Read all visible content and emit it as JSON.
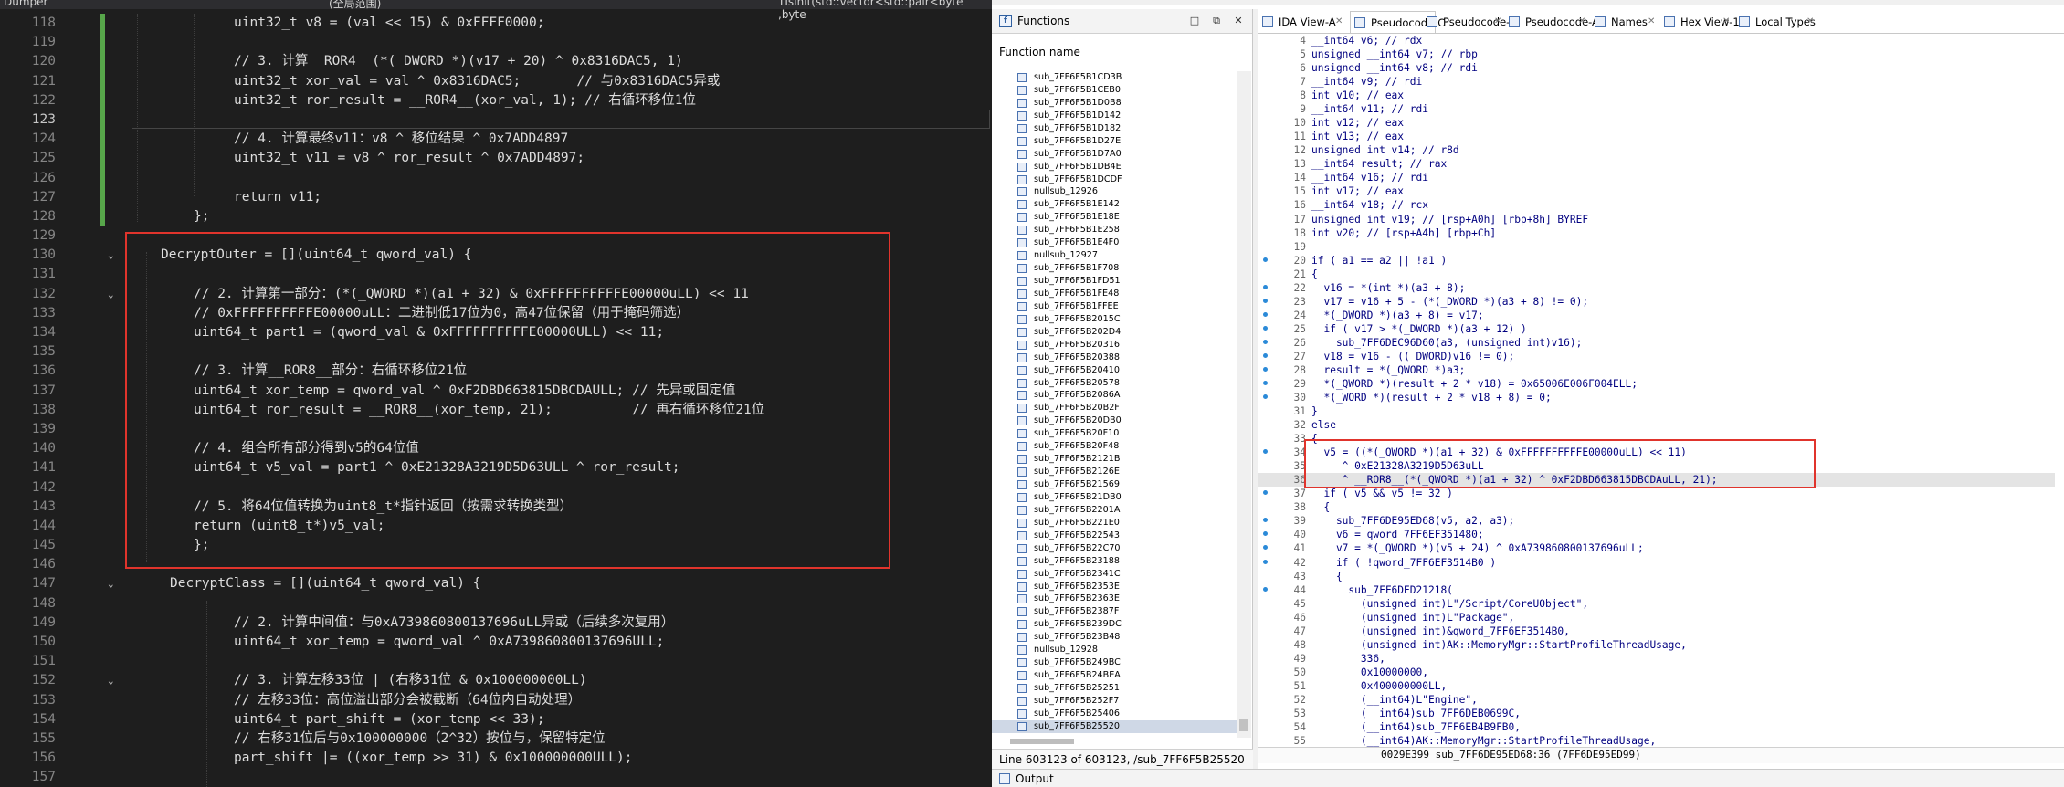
{
  "editor": {
    "window_title": "Dumper",
    "scope_label": "(全局范围)",
    "symbol_label": "TIsInit(std::vector<std::pair<byte ,byte",
    "lines": [
      {
        "n": "118",
        "indent": 2,
        "text": "uint32_t v8 = (val << 15) & 0xFFFF0000;"
      },
      {
        "n": "119",
        "indent": 0,
        "text": ""
      },
      {
        "n": "120",
        "indent": 2,
        "text": "// 3. 计算__ROR4__(*(_DWORD *)(v17 + 20) ^ 0x8316DAC5, 1)"
      },
      {
        "n": "121",
        "indent": 2,
        "text": "uint32_t xor_val = val ^ 0x8316DAC5;       // 与0x8316DAC5异或"
      },
      {
        "n": "122",
        "indent": 2,
        "text": "uint32_t ror_result = __ROR4__(xor_val, 1); // 右循环移位1位"
      },
      {
        "n": "123",
        "indent": 0,
        "text": ""
      },
      {
        "n": "124",
        "indent": 2,
        "text": "// 4. 计算最终v11：v8 ^ 移位结果 ^ 0x7ADD4897"
      },
      {
        "n": "125",
        "indent": 2,
        "text": "uint32_t v11 = v8 ^ ror_result ^ 0x7ADD4897;"
      },
      {
        "n": "126",
        "indent": 0,
        "text": ""
      },
      {
        "n": "127",
        "indent": 2,
        "text": "return v11;"
      },
      {
        "n": "128",
        "indent": 1,
        "text": "};"
      },
      {
        "n": "129",
        "indent": 0,
        "text": ""
      },
      {
        "n": "130",
        "indent": 0,
        "text": "DecryptOuter = [](uint64_t qword_val) {"
      },
      {
        "n": "131",
        "indent": 0,
        "text": ""
      },
      {
        "n": "132",
        "indent": 1,
        "text": "// 2. 计算第一部分：(*(_QWORD *)(a1 + 32) & 0xFFFFFFFFFFE00000uLL) << 11"
      },
      {
        "n": "133",
        "indent": 1,
        "text": "// 0xFFFFFFFFFFE00000uLL：二进制低17位为0，高47位保留（用于掩码筛选）"
      },
      {
        "n": "134",
        "indent": 1,
        "text": "uint64_t part1 = (qword_val & 0xFFFFFFFFFFE00000ULL) << 11;"
      },
      {
        "n": "135",
        "indent": 0,
        "text": ""
      },
      {
        "n": "136",
        "indent": 1,
        "text": "// 3. 计算__ROR8__部分：右循环移位21位"
      },
      {
        "n": "137",
        "indent": 1,
        "text": "uint64_t xor_temp = qword_val ^ 0xF2DBD663815DBCDAULL; // 先异或固定值"
      },
      {
        "n": "138",
        "indent": 1,
        "text": "uint64_t ror_result = __ROR8__(xor_temp, 21);          // 再右循环移位21位"
      },
      {
        "n": "139",
        "indent": 0,
        "text": ""
      },
      {
        "n": "140",
        "indent": 1,
        "text": "// 4. 组合所有部分得到v5的64位值"
      },
      {
        "n": "141",
        "indent": 1,
        "text": "uint64_t v5_val = part1 ^ 0xE21328A3219D5D63ULL ^ ror_result;"
      },
      {
        "n": "142",
        "indent": 0,
        "text": ""
      },
      {
        "n": "143",
        "indent": 1,
        "text": "// 5. 将64位值转换为uint8_t*指针返回（按需求转换类型）"
      },
      {
        "n": "144",
        "indent": 1,
        "text": "return (uint8_t*)v5_val;"
      },
      {
        "n": "145",
        "indent": 1,
        "text": "};"
      },
      {
        "n": "146",
        "indent": 0,
        "text": ""
      },
      {
        "n": "147",
        "indent": 0,
        "text": "DecryptClass = [](uint64_t qword_val) {"
      },
      {
        "n": "148",
        "indent": 0,
        "text": ""
      },
      {
        "n": "149",
        "indent": 2,
        "text": "// 2. 计算中间值：与0xA739860800137696uLL异或（后续多次复用）"
      },
      {
        "n": "150",
        "indent": 2,
        "text": "uint64_t xor_temp = qword_val ^ 0xA739860800137696ULL;"
      },
      {
        "n": "151",
        "indent": 0,
        "text": ""
      },
      {
        "n": "152",
        "indent": 2,
        "text": "// 3. 计算左移33位 | (右移31位 & 0x100000000LL)"
      },
      {
        "n": "153",
        "indent": 2,
        "text": "// 左移33位：高位溢出部分会被截断（64位内自动处理）"
      },
      {
        "n": "154",
        "indent": 2,
        "text": "uint64_t part_shift = (xor_temp << 33);"
      },
      {
        "n": "155",
        "indent": 2,
        "text": "// 右移31位后与0x100000000（2^32）按位与，保留特定位"
      },
      {
        "n": "156",
        "indent": 2,
        "text": "part_shift |= ((xor_temp >> 31) & 0x100000000ULL);"
      },
      {
        "n": "157",
        "indent": 0,
        "text": ""
      }
    ]
  },
  "functions": {
    "title": "Functions",
    "column_header": "Function name",
    "items": [
      "sub_7FF6F5B1CD3B",
      "sub_7FF6F5B1CEB0",
      "sub_7FF6F5B1D0B8",
      "sub_7FF6F5B1D142",
      "sub_7FF6F5B1D182",
      "sub_7FF6F5B1D27E",
      "sub_7FF6F5B1D7A0",
      "sub_7FF6F5B1DB4E",
      "sub_7FF6F5B1DCDF",
      "nullsub_12926",
      "sub_7FF6F5B1E142",
      "sub_7FF6F5B1E18E",
      "sub_7FF6F5B1E258",
      "sub_7FF6F5B1E4F0",
      "nullsub_12927",
      "sub_7FF6F5B1F708",
      "sub_7FF6F5B1FD51",
      "sub_7FF6F5B1FE48",
      "sub_7FF6F5B1FFEE",
      "sub_7FF6F5B2015C",
      "sub_7FF6F5B202D4",
      "sub_7FF6F5B20316",
      "sub_7FF6F5B20388",
      "sub_7FF6F5B20410",
      "sub_7FF6F5B20578",
      "sub_7FF6F5B2086A",
      "sub_7FF6F5B20B2F",
      "sub_7FF6F5B20DB0",
      "sub_7FF6F5B20F10",
      "sub_7FF6F5B20F48",
      "sub_7FF6F5B2121B",
      "sub_7FF6F5B2126E",
      "sub_7FF6F5B21569",
      "sub_7FF6F5B21DB0",
      "sub_7FF6F5B2201A",
      "sub_7FF6F5B221E0",
      "sub_7FF6F5B22543",
      "sub_7FF6F5B22C70",
      "sub_7FF6F5B23188",
      "sub_7FF6F5B2341C",
      "sub_7FF6F5B2353E",
      "sub_7FF6F5B2363E",
      "sub_7FF6F5B2387F",
      "sub_7FF6F5B239DC",
      "sub_7FF6F5B23B48",
      "nullsub_12928",
      "sub_7FF6F5B249BC",
      "sub_7FF6F5B24BEA",
      "sub_7FF6F5B25251",
      "sub_7FF6F5B252F7",
      "sub_7FF6F5B25406",
      "sub_7FF6F5B25520"
    ],
    "status": "Line 603123 of 603123, /sub_7FF6F5B25520"
  },
  "tabs": [
    {
      "label": "IDA View-A",
      "active": false
    },
    {
      "label": "Pseudocode-C",
      "active": true
    },
    {
      "label": "Pseudocode-B",
      "active": false
    },
    {
      "label": "Pseudocode-A",
      "active": false
    },
    {
      "label": "Names",
      "active": false
    },
    {
      "label": "Hex View-1",
      "active": false
    },
    {
      "label": "Local Types",
      "active": false
    }
  ],
  "pseudocode": {
    "lines": [
      {
        "n": "4",
        "bp": false,
        "text": "__int64 v6; // rdx"
      },
      {
        "n": "5",
        "bp": false,
        "text": "unsigned __int64 v7; // rbp"
      },
      {
        "n": "6",
        "bp": false,
        "text": "unsigned __int64 v8; // rdi"
      },
      {
        "n": "7",
        "bp": false,
        "text": "__int64 v9; // rdi"
      },
      {
        "n": "8",
        "bp": false,
        "text": "int v10; // eax"
      },
      {
        "n": "9",
        "bp": false,
        "text": "__int64 v11; // rdi"
      },
      {
        "n": "10",
        "bp": false,
        "text": "int v12; // eax"
      },
      {
        "n": "11",
        "bp": false,
        "text": "int v13; // eax"
      },
      {
        "n": "12",
        "bp": false,
        "text": "unsigned int v14; // r8d"
      },
      {
        "n": "13",
        "bp": false,
        "text": "__int64 result; // rax"
      },
      {
        "n": "14",
        "bp": false,
        "text": "__int64 v16; // rdi"
      },
      {
        "n": "15",
        "bp": false,
        "text": "int v17; // eax"
      },
      {
        "n": "16",
        "bp": false,
        "text": "__int64 v18; // rcx"
      },
      {
        "n": "17",
        "bp": false,
        "text": "unsigned int v19; // [rsp+A0h] [rbp+8h] BYREF"
      },
      {
        "n": "18",
        "bp": false,
        "text": "int v20; // [rsp+A4h] [rbp+Ch]"
      },
      {
        "n": "19",
        "bp": false,
        "text": ""
      },
      {
        "n": "20",
        "bp": true,
        "text": "if ( a1 == a2 || !a1 )"
      },
      {
        "n": "21",
        "bp": false,
        "text": "{"
      },
      {
        "n": "22",
        "bp": true,
        "text": "  v16 = *(int *)(a3 + 8);"
      },
      {
        "n": "23",
        "bp": true,
        "text": "  v17 = v16 + 5 - (*(_DWORD *)(a3 + 8) != 0);"
      },
      {
        "n": "24",
        "bp": true,
        "text": "  *(_DWORD *)(a3 + 8) = v17;"
      },
      {
        "n": "25",
        "bp": true,
        "text": "  if ( v17 > *(_DWORD *)(a3 + 12) )"
      },
      {
        "n": "26",
        "bp": true,
        "text": "    sub_7FF6DEC96D60(a3, (unsigned int)v16);"
      },
      {
        "n": "27",
        "bp": true,
        "text": "  v18 = v16 - ((_DWORD)v16 != 0);"
      },
      {
        "n": "28",
        "bp": true,
        "text": "  result = *(_QWORD *)a3;"
      },
      {
        "n": "29",
        "bp": true,
        "text": "  *(_QWORD *)(result + 2 * v18) = 0x65006E006F004ELL;"
      },
      {
        "n": "30",
        "bp": true,
        "text": "  *(_WORD *)(result + 2 * v18 + 8) = 0;"
      },
      {
        "n": "31",
        "bp": false,
        "text": "}"
      },
      {
        "n": "32",
        "bp": false,
        "text": "else"
      },
      {
        "n": "33",
        "bp": false,
        "text": "{"
      },
      {
        "n": "34",
        "bp": true,
        "text": "  v5 = ((*(_QWORD *)(a1 + 32) & 0xFFFFFFFFFFE00000uLL) << 11)"
      },
      {
        "n": "35",
        "bp": false,
        "text": "     ^ 0xE21328A3219D5D63uLL"
      },
      {
        "n": "36",
        "bp": false,
        "text": "     ^ __ROR8__(*(_QWORD *)(a1 + 32) ^ 0xF2DBD663815DBCDAuLL, 21);"
      },
      {
        "n": "37",
        "bp": true,
        "text": "  if ( v5 && v5 != 32 )"
      },
      {
        "n": "38",
        "bp": false,
        "text": "  {"
      },
      {
        "n": "39",
        "bp": true,
        "text": "    sub_7FF6DE95ED68(v5, a2, a3);"
      },
      {
        "n": "40",
        "bp": true,
        "text": "    v6 = qword_7FF6EF351480;"
      },
      {
        "n": "41",
        "bp": true,
        "text": "    v7 = *(_QWORD *)(v5 + 24) ^ 0xA739860800137696uLL;"
      },
      {
        "n": "42",
        "bp": true,
        "text": "    if ( !qword_7FF6EF3514B0 )"
      },
      {
        "n": "43",
        "bp": false,
        "text": "    {"
      },
      {
        "n": "44",
        "bp": true,
        "text": "      sub_7FF6DED21218("
      },
      {
        "n": "45",
        "bp": false,
        "text": "        (unsigned int)L\"/Script/CoreUObject\","
      },
      {
        "n": "46",
        "bp": false,
        "text": "        (unsigned int)L\"Package\","
      },
      {
        "n": "47",
        "bp": false,
        "text": "        (unsigned int)&qword_7FF6EF3514B0,"
      },
      {
        "n": "48",
        "bp": false,
        "text": "        (unsigned int)AK::MemoryMgr::StartProfileThreadUsage,"
      },
      {
        "n": "49",
        "bp": false,
        "text": "        336,"
      },
      {
        "n": "50",
        "bp": false,
        "text": "        0x10000000,"
      },
      {
        "n": "51",
        "bp": false,
        "text": "        0x400000000LL,"
      },
      {
        "n": "52",
        "bp": false,
        "text": "        (__int64)L\"Engine\","
      },
      {
        "n": "53",
        "bp": false,
        "text": "        (__int64)sub_7FF6DEB0699C,"
      },
      {
        "n": "54",
        "bp": false,
        "text": "        (__int64)sub_7FF6EB4B9FB0,"
      },
      {
        "n": "55",
        "bp": false,
        "text": "        (__int64)AK::MemoryMgr::StartProfileThreadUsage,"
      }
    ],
    "status": "0029E399 sub_7FF6DE95ED68:36 (7FF6DE95ED99)"
  },
  "output": {
    "label": "Output"
  },
  "colors": {
    "highlight_box": "#e0342c",
    "change_bar": "#57a64a",
    "editor_bg": "#1e1e1e"
  }
}
